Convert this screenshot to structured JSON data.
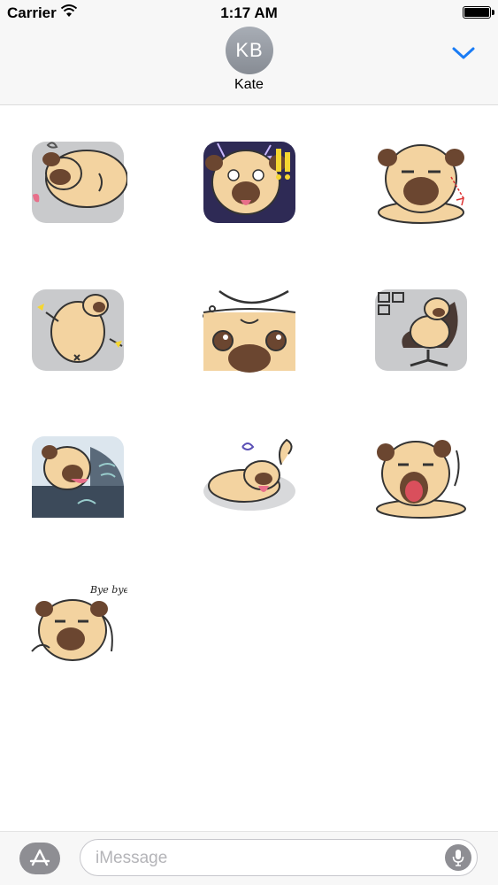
{
  "status_bar": {
    "carrier": "Carrier",
    "time": "1:17 AM",
    "icons": [
      "wifi-icon",
      "battery-icon"
    ]
  },
  "header": {
    "avatar_initials": "KB",
    "contact_name": "Kate",
    "collapse_icon": "chevron-down-icon",
    "accent_color": "#1a7cf5"
  },
  "stickers": [
    {
      "name": "sleepy-pug-sticker"
    },
    {
      "name": "shocked-pug-sticker"
    },
    {
      "name": "annoyed-pug-sticker"
    },
    {
      "name": "falling-pug-sticker"
    },
    {
      "name": "thinking-pug-sticker"
    },
    {
      "name": "office-chair-pug-sticker"
    },
    {
      "name": "car-window-pug-sticker"
    },
    {
      "name": "lying-pug-sticker"
    },
    {
      "name": "yawning-pug-sticker"
    },
    {
      "name": "bye-bye-pug-sticker",
      "caption": "Bye bye!"
    }
  ],
  "input_bar": {
    "placeholder": "iMessage",
    "left_icon": "app-store-icon",
    "right_icon": "microphone-icon"
  }
}
